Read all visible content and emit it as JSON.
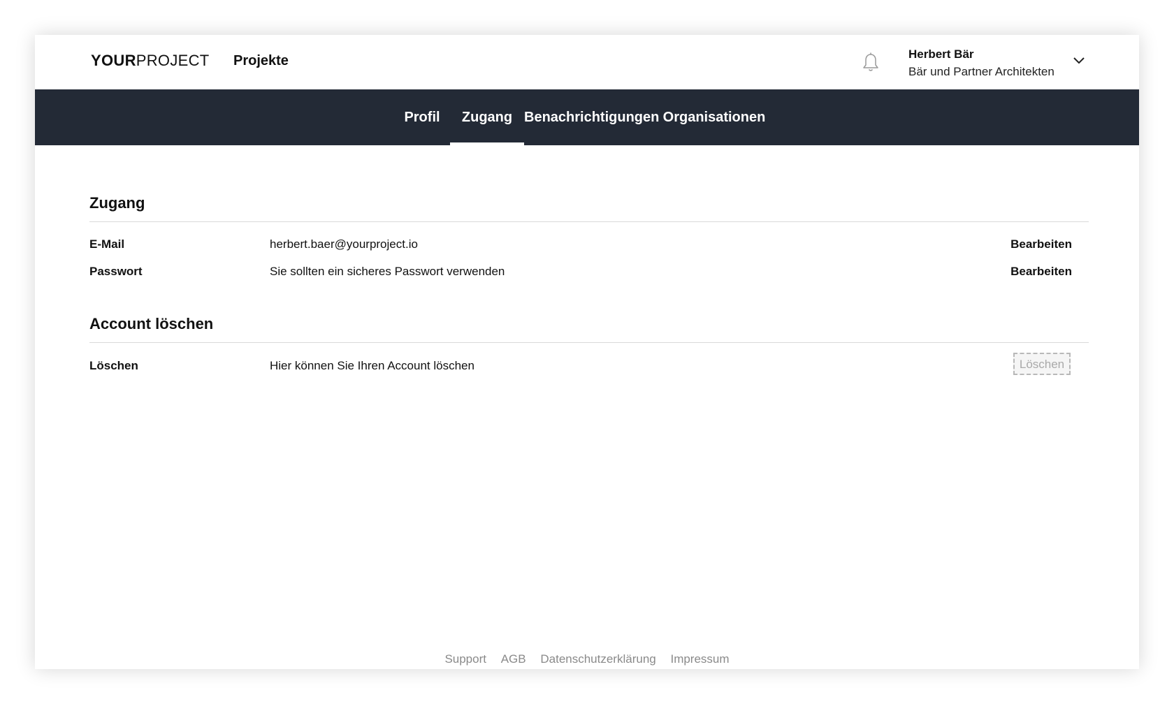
{
  "header": {
    "logo_bold": "YOUR",
    "logo_light": "PROJECT",
    "nav_projects": "Projekte",
    "user_name": "Herbert Bär",
    "user_org": "Bär und Partner Architekten"
  },
  "tabs": [
    {
      "label": "Profil",
      "active": false
    },
    {
      "label": "Zugang",
      "active": true
    },
    {
      "label": "Benachrichtigungen",
      "active": false
    },
    {
      "label": "Organisationen",
      "active": false
    }
  ],
  "access": {
    "title": "Zugang",
    "rows": [
      {
        "label": "E-Mail",
        "value": "herbert.baer@yourproject.io",
        "action": "Bearbeiten"
      },
      {
        "label": "Passwort",
        "value": "Sie sollten ein sicheres Passwort verwenden",
        "action": "Bearbeiten"
      }
    ]
  },
  "delete_account": {
    "title": "Account löschen",
    "label": "Löschen",
    "value": "Hier können Sie Ihren Account löschen",
    "button": "Löschen"
  },
  "footer": {
    "links": [
      "Support",
      "AGB",
      "Datenschutzerklärung",
      "Impressum"
    ]
  },
  "colors": {
    "tabbar_bg": "#232a36",
    "footer_text": "#8a8a8a"
  },
  "icons": {
    "notifications": "bell-icon",
    "user_menu": "chevron-down-icon"
  }
}
